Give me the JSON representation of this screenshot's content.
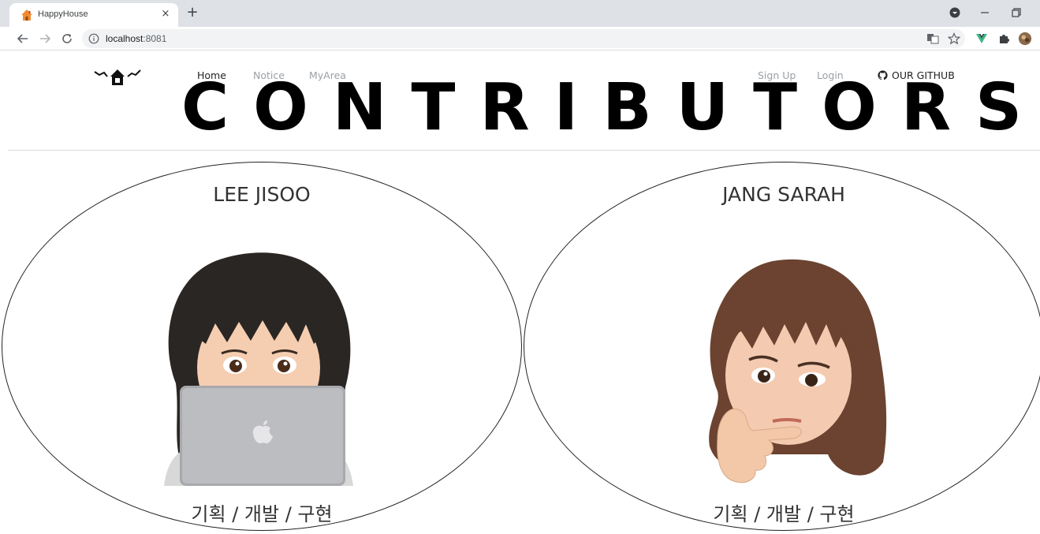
{
  "browser": {
    "tab_title": "HappyHouse",
    "tab_close": "×",
    "new_tab": "+",
    "url_host": "localhost",
    "url_port": ":8081"
  },
  "nav": {
    "left": [
      "Home",
      "Notice",
      "MyArea"
    ],
    "right": [
      "Sign Up",
      "Login"
    ],
    "github": "OUR GITHUB"
  },
  "hero": {
    "title": "CONTRIBUTORS"
  },
  "contributors": [
    {
      "name": "LEE JISOO",
      "role": "기획 / 개발 / 구현"
    },
    {
      "name": "JANG SARAH",
      "role": "기획 / 개발 / 구현"
    }
  ],
  "colors": {
    "chrome_bg": "#dee1e6",
    "omnibox_bg": "#f1f3f4",
    "vue_green": "#41b883"
  }
}
